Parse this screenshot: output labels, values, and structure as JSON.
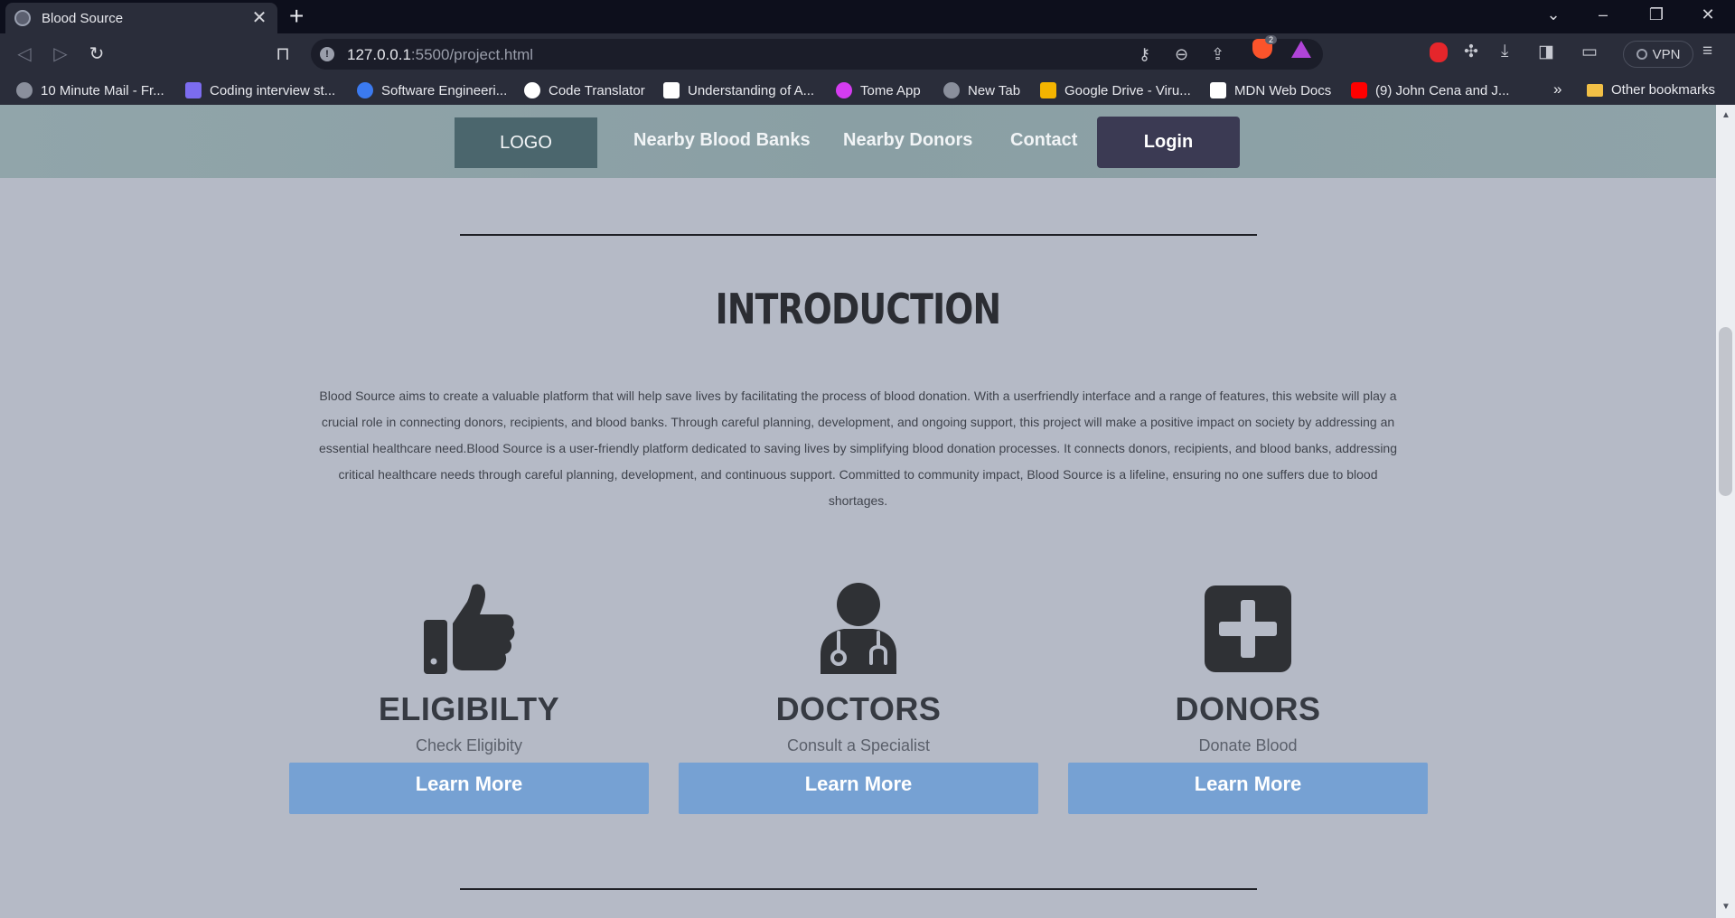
{
  "browser": {
    "tab_title": "Blood Source",
    "url_host": "127.0.0.1",
    "url_rest": ":5500/project.html",
    "brave_badge": "2",
    "vpn_label": "VPN",
    "bookmarks": [
      {
        "label": "10 Minute Mail - Fr...",
        "color": "#8a8f9c"
      },
      {
        "label": "Coding interview st...",
        "color": "#7c6cf0"
      },
      {
        "label": "Software Engineeri...",
        "color": "#3b7af0"
      },
      {
        "label": "Code Translator",
        "color": "#ffffff"
      },
      {
        "label": "Understanding of A...",
        "color": "#ffffff"
      },
      {
        "label": "Tome App",
        "color": "#d43cf0"
      },
      {
        "label": "New Tab",
        "color": "#8a8f9c"
      },
      {
        "label": "Google Drive - Viru...",
        "color": "#f4b400"
      },
      {
        "label": "MDN Web Docs",
        "color": "#ffffff"
      },
      {
        "label": "(9) John Cena and J...",
        "color": "#ff0000"
      }
    ],
    "bookmarks_more": "»",
    "other_bookmarks": "Other bookmarks"
  },
  "site": {
    "nav": {
      "logo": "LOGO",
      "links": [
        "Nearby Blood Banks",
        "Nearby Donors",
        "Contact"
      ],
      "login": "Login"
    },
    "intro": {
      "title": "INTRODUCTION",
      "text": "Blood Source aims to create a valuable platform that will help save lives by facilitating the process of blood donation. With a userfriendly interface and a range of features, this website will play a crucial role in connecting donors, recipients, and blood banks. Through careful planning, development, and ongoing support, this project will make a positive impact on society by addressing an essential healthcare need.Blood Source is a user-friendly platform dedicated to saving lives by simplifying blood donation processes. It connects donors, recipients, and blood banks, addressing critical healthcare needs through careful planning, development, and continuous support. Committed to community impact, Blood Source is a lifeline, ensuring no one suffers due to blood shortages."
    },
    "cards": [
      {
        "icon": "thumbs-up-icon",
        "title": "ELIGIBILTY",
        "subtitle": "Check Eligibity",
        "button": "Learn More"
      },
      {
        "icon": "doctor-icon",
        "title": "DOCTORS",
        "subtitle": "Consult a Specialist",
        "button": "Learn More"
      },
      {
        "icon": "medical-plus-icon",
        "title": "DONORS",
        "subtitle": "Donate Blood",
        "button": "Learn More"
      }
    ],
    "colors": {
      "page_bg": "#b5bac6",
      "button_bg": "#76a1d3",
      "login_bg": "#3b3a53",
      "logo_bg": "#4b666d",
      "icon_color": "#2f3135"
    }
  }
}
